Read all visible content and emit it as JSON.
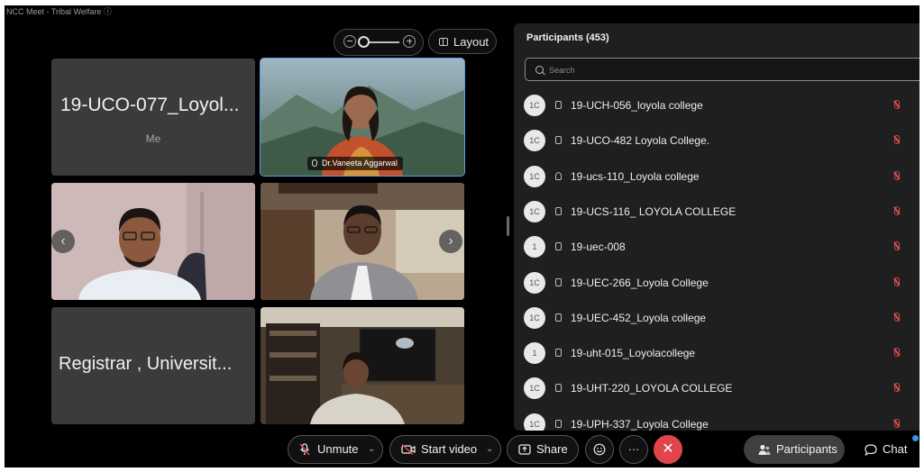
{
  "window": {
    "title": "NCC Meet - Tribal Welfare ⓘ"
  },
  "top_controls": {
    "layout_label": "Layout"
  },
  "video_tiles": [
    {
      "name": "19-UCO-077_Loyol...",
      "sub": "Me"
    },
    {
      "nametag": "Dr.Vaneeta Aggarwal"
    },
    {
      "name": ""
    },
    {
      "name": ""
    },
    {
      "name": "Registrar , Universit..."
    },
    {
      "name": ""
    }
  ],
  "participants": {
    "title": "Participants (453)",
    "search_placeholder": "Search",
    "items": [
      {
        "avatar": "1C",
        "name": "19-UCH-056_loyola college",
        "device": "video"
      },
      {
        "avatar": "1C",
        "name": "19-UCO-482 Loyola College.",
        "device": "video"
      },
      {
        "avatar": "1C",
        "name": "19-ucs-110_Loyola college",
        "device": "phone"
      },
      {
        "avatar": "1C",
        "name": "19-UCS-116_ LOYOLA COLLEGE",
        "device": "video"
      },
      {
        "avatar": "1",
        "name": "19-uec-008",
        "device": "video"
      },
      {
        "avatar": "1C",
        "name": "19-UEC-266_Loyola College",
        "device": "video"
      },
      {
        "avatar": "1C",
        "name": "19-UEC-452_Loyola college",
        "device": "video"
      },
      {
        "avatar": "1",
        "name": "19-uht-015_Loyolacollege",
        "device": "video"
      },
      {
        "avatar": "1C",
        "name": "19-UHT-220_LOYOLA COLLEGE",
        "device": "video"
      },
      {
        "avatar": "1C",
        "name": "19-UPH-337_Loyola College",
        "device": "video"
      }
    ]
  },
  "toolbar": {
    "unmute": "Unmute",
    "start_video": "Start video",
    "share": "Share",
    "more": "···",
    "leave": "✕",
    "participants": "Participants",
    "chat": "Chat"
  },
  "colors": {
    "leave": "#e0454b",
    "active_speaker": "#5a9ee6",
    "muted_icon": "#d64a4a",
    "panel_bg": "#1f1f1f"
  }
}
